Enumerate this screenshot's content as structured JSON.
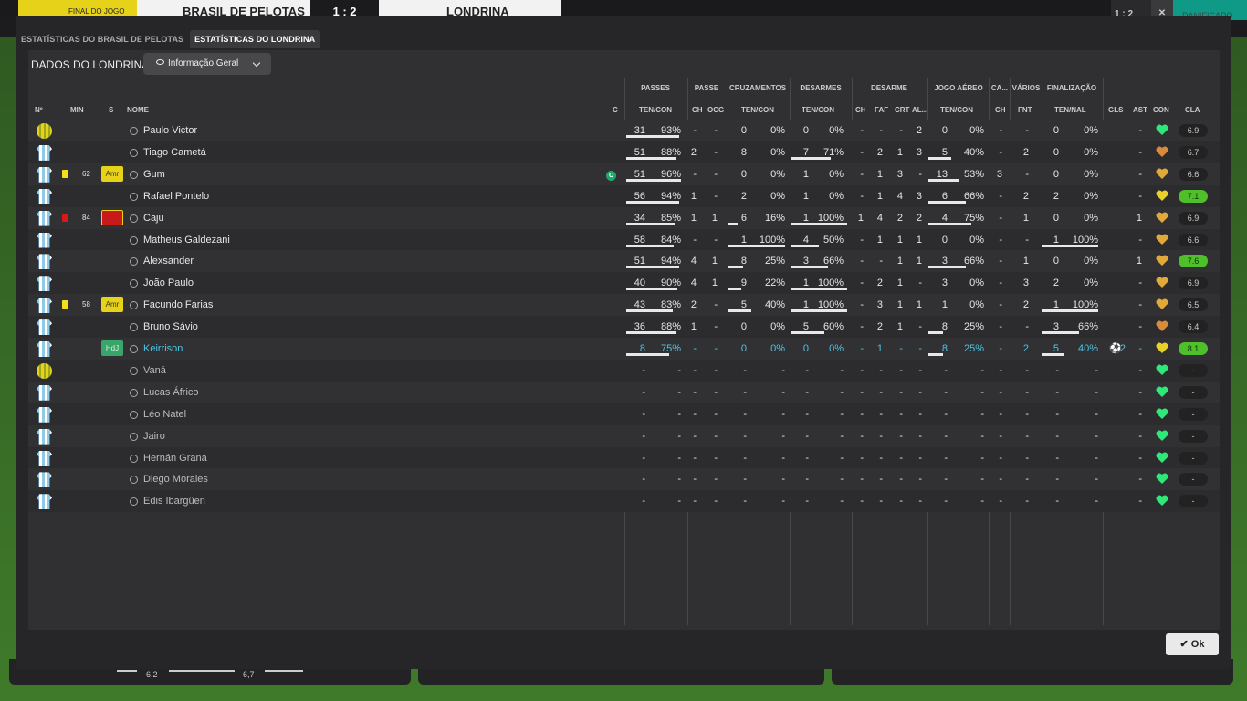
{
  "topbar": {
    "status": "FINAL DO JOGO",
    "home": "BRASIL DE PELOTAS",
    "score": "1 : 2",
    "away": "LONDRINA",
    "right_score": "1 : 2",
    "right_label": "DANIFICADO"
  },
  "bottom": {
    "val1": "6,2",
    "val2": "6,7"
  },
  "tabs": [
    {
      "label": "ESTATÍSTICAS DO BRASIL DE PELOTAS"
    },
    {
      "label": "ESTATÍSTICAS DO LONDRINA"
    }
  ],
  "panel": {
    "title": "DADOS DO LONDRINA",
    "dropdown": "Informação Geral"
  },
  "groups": [
    "PASSES",
    "PASSE",
    "CRUZAMENTOS",
    "DESARMES",
    "DESARME",
    "JOGO AÉREO",
    "CA...",
    "VÁRIOS",
    "FINALIZAÇÃO"
  ],
  "cols": {
    "no": "Nº",
    "min": "MIN",
    "s": "S",
    "name": "NOME",
    "c": "C",
    "passes": "TEN/CON",
    "passe_ch": "CH",
    "passe_ocg": "OCG",
    "cruz": "TEN/CON",
    "desarmes": "TEN/CON",
    "des_ch": "CH",
    "des_faf": "FAF",
    "des_crt": "CRT",
    "des_al": "AL...",
    "aereo": "TEN/CON",
    "ca_ch": "CH",
    "varios_fnt": "FNT",
    "final": "TEN/NAL",
    "gls": "GLS",
    "ast": "AST",
    "con": "CON",
    "cla": "CLA"
  },
  "players": [
    {
      "name": "Paulo Victor",
      "gk": true,
      "min": "",
      "badge": "",
      "card": "",
      "pt": "31",
      "pp": "93%",
      "pch": "-",
      "pocg": "-",
      "ct": "0",
      "cp": "0%",
      "dt": "0",
      "dp": "0%",
      "dch": "-",
      "dfaf": "-",
      "dcrt": "-",
      "dal": "2",
      "at": "0",
      "ap": "0%",
      "cach": "-",
      "fnt": "-",
      "ft": "0",
      "fp": "0%",
      "gls": "",
      "ast": "-",
      "rating": "6.9",
      "good": false,
      "heart": "green"
    },
    {
      "name": "Tiago Cametá",
      "gk": false,
      "min": "",
      "badge": "",
      "card": "",
      "pt": "51",
      "pp": "88%",
      "pch": "2",
      "pocg": "-",
      "ct": "8",
      "cp": "0%",
      "dt": "7",
      "dp": "71%",
      "dch": "-",
      "dfaf": "2",
      "dcrt": "1",
      "dal": "3",
      "at": "5",
      "ap": "40%",
      "cach": "-",
      "fnt": "2",
      "ft": "0",
      "fp": "0%",
      "gls": "",
      "ast": "-",
      "rating": "6.7",
      "good": false,
      "heart": "orange"
    },
    {
      "name": "Gum",
      "gk": false,
      "min": "62",
      "badge": "Amr",
      "card": "yellow",
      "cap": true,
      "pt": "51",
      "pp": "96%",
      "pch": "-",
      "pocg": "-",
      "ct": "0",
      "cp": "0%",
      "dt": "1",
      "dp": "0%",
      "dch": "-",
      "dfaf": "1",
      "dcrt": "3",
      "dal": "-",
      "at": "13",
      "ap": "53%",
      "cach": "3",
      "fnt": "-",
      "ft": "0",
      "fp": "0%",
      "gls": "",
      "ast": "-",
      "rating": "6.6",
      "good": false,
      "heart": "gold"
    },
    {
      "name": "Rafael Pontelo",
      "gk": false,
      "min": "",
      "badge": "",
      "card": "",
      "pt": "56",
      "pp": "94%",
      "pch": "1",
      "pocg": "-",
      "ct": "2",
      "cp": "0%",
      "dt": "1",
      "dp": "0%",
      "dch": "-",
      "dfaf": "1",
      "dcrt": "4",
      "dal": "3",
      "at": "6",
      "ap": "66%",
      "cach": "-",
      "fnt": "2",
      "ft": "2",
      "fp": "0%",
      "gls": "",
      "ast": "-",
      "rating": "7.1",
      "good": true,
      "heart": "yellow"
    },
    {
      "name": "Caju",
      "gk": false,
      "min": "84",
      "badge": "Vrm",
      "card": "red",
      "pt": "34",
      "pp": "85%",
      "pch": "1",
      "pocg": "1",
      "ct": "6",
      "cp": "16%",
      "dt": "1",
      "dp": "100%",
      "dch": "1",
      "dfaf": "4",
      "dcrt": "2",
      "dal": "2",
      "at": "4",
      "ap": "75%",
      "cach": "-",
      "fnt": "1",
      "ft": "0",
      "fp": "0%",
      "gls": "",
      "ast": "1",
      "rating": "6.9",
      "good": false,
      "heart": "gold"
    },
    {
      "name": "Matheus Galdezani",
      "gk": false,
      "min": "",
      "badge": "",
      "card": "",
      "pt": "58",
      "pp": "84%",
      "pch": "-",
      "pocg": "-",
      "ct": "1",
      "cp": "100%",
      "dt": "4",
      "dp": "50%",
      "dch": "-",
      "dfaf": "1",
      "dcrt": "1",
      "dal": "1",
      "at": "0",
      "ap": "0%",
      "cach": "-",
      "fnt": "-",
      "ft": "1",
      "fp": "100%",
      "gls": "",
      "ast": "-",
      "rating": "6.6",
      "good": false,
      "heart": "gold"
    },
    {
      "name": "Alexsander",
      "gk": false,
      "min": "",
      "badge": "",
      "card": "",
      "pt": "51",
      "pp": "94%",
      "pch": "4",
      "pocg": "1",
      "ct": "8",
      "cp": "25%",
      "dt": "3",
      "dp": "66%",
      "dch": "-",
      "dfaf": "-",
      "dcrt": "1",
      "dal": "1",
      "at": "3",
      "ap": "66%",
      "cach": "-",
      "fnt": "1",
      "ft": "0",
      "fp": "0%",
      "gls": "",
      "ast": "1",
      "rating": "7.6",
      "good": true,
      "heart": "gold"
    },
    {
      "name": "João Paulo",
      "gk": false,
      "min": "",
      "badge": "",
      "card": "",
      "pt": "40",
      "pp": "90%",
      "pch": "4",
      "pocg": "1",
      "ct": "9",
      "cp": "22%",
      "dt": "1",
      "dp": "100%",
      "dch": "-",
      "dfaf": "2",
      "dcrt": "1",
      "dal": "-",
      "at": "3",
      "ap": "0%",
      "cach": "-",
      "fnt": "3",
      "ft": "2",
      "fp": "0%",
      "gls": "",
      "ast": "-",
      "rating": "6.9",
      "good": false,
      "heart": "gold"
    },
    {
      "name": "Facundo Farias",
      "gk": false,
      "min": "58",
      "badge": "Amr",
      "card": "yellow",
      "pt": "43",
      "pp": "83%",
      "pch": "2",
      "pocg": "-",
      "ct": "5",
      "cp": "40%",
      "dt": "1",
      "dp": "100%",
      "dch": "-",
      "dfaf": "3",
      "dcrt": "1",
      "dal": "1",
      "at": "1",
      "ap": "0%",
      "cach": "-",
      "fnt": "2",
      "ft": "1",
      "fp": "100%",
      "gls": "",
      "ast": "-",
      "rating": "6.5",
      "good": false,
      "heart": "gold"
    },
    {
      "name": "Bruno Sávio",
      "gk": false,
      "min": "",
      "badge": "",
      "card": "",
      "pt": "36",
      "pp": "88%",
      "pch": "1",
      "pocg": "-",
      "ct": "0",
      "cp": "0%",
      "dt": "5",
      "dp": "60%",
      "dch": "-",
      "dfaf": "2",
      "dcrt": "1",
      "dal": "-",
      "at": "8",
      "ap": "25%",
      "cach": "-",
      "fnt": "-",
      "ft": "3",
      "fp": "66%",
      "gls": "",
      "ast": "-",
      "rating": "6.4",
      "good": false,
      "heart": "orange"
    },
    {
      "name": "Keirrison",
      "gk": false,
      "min": "",
      "badge": "HdJ",
      "card": "",
      "highlight": true,
      "pt": "8",
      "pp": "75%",
      "pch": "-",
      "pocg": "-",
      "ct": "0",
      "cp": "0%",
      "dt": "0",
      "dp": "0%",
      "dch": "-",
      "dfaf": "1",
      "dcrt": "-",
      "dal": "-",
      "at": "8",
      "ap": "25%",
      "cach": "-",
      "fnt": "2",
      "ft": "5",
      "fp": "40%",
      "gls": "2",
      "ast": "-",
      "rating": "8.1",
      "good": true,
      "heart": "yellow"
    },
    {
      "name": "Vaná",
      "gk": true,
      "sub": true,
      "pt": "-",
      "pp": "-",
      "pch": "-",
      "pocg": "-",
      "ct": "-",
      "cp": "-",
      "dt": "-",
      "dp": "-",
      "dch": "-",
      "dfaf": "-",
      "dcrt": "-",
      "dal": "-",
      "at": "-",
      "ap": "-",
      "cach": "-",
      "fnt": "-",
      "ft": "-",
      "fp": "-",
      "gls": "",
      "ast": "-",
      "rating": "-",
      "good": false,
      "heart": "green"
    },
    {
      "name": "Lucas Áfrico",
      "gk": false,
      "sub": true,
      "pt": "-",
      "pp": "-",
      "pch": "-",
      "pocg": "-",
      "ct": "-",
      "cp": "-",
      "dt": "-",
      "dp": "-",
      "dch": "-",
      "dfaf": "-",
      "dcrt": "-",
      "dal": "-",
      "at": "-",
      "ap": "-",
      "cach": "-",
      "fnt": "-",
      "ft": "-",
      "fp": "-",
      "gls": "",
      "ast": "-",
      "rating": "-",
      "good": false,
      "heart": "green"
    },
    {
      "name": "Léo Natel",
      "gk": false,
      "sub": true,
      "pt": "-",
      "pp": "-",
      "pch": "-",
      "pocg": "-",
      "ct": "-",
      "cp": "-",
      "dt": "-",
      "dp": "-",
      "dch": "-",
      "dfaf": "-",
      "dcrt": "-",
      "dal": "-",
      "at": "-",
      "ap": "-",
      "cach": "-",
      "fnt": "-",
      "ft": "-",
      "fp": "-",
      "gls": "",
      "ast": "-",
      "rating": "-",
      "good": false,
      "heart": "green"
    },
    {
      "name": "Jairo",
      "gk": false,
      "sub": true,
      "pt": "-",
      "pp": "-",
      "pch": "-",
      "pocg": "-",
      "ct": "-",
      "cp": "-",
      "dt": "-",
      "dp": "-",
      "dch": "-",
      "dfaf": "-",
      "dcrt": "-",
      "dal": "-",
      "at": "-",
      "ap": "-",
      "cach": "-",
      "fnt": "-",
      "ft": "-",
      "fp": "-",
      "gls": "",
      "ast": "-",
      "rating": "-",
      "good": false,
      "heart": "green"
    },
    {
      "name": "Hernán Grana",
      "gk": false,
      "sub": true,
      "pt": "-",
      "pp": "-",
      "pch": "-",
      "pocg": "-",
      "ct": "-",
      "cp": "-",
      "dt": "-",
      "dp": "-",
      "dch": "-",
      "dfaf": "-",
      "dcrt": "-",
      "dal": "-",
      "at": "-",
      "ap": "-",
      "cach": "-",
      "fnt": "-",
      "ft": "-",
      "fp": "-",
      "gls": "",
      "ast": "-",
      "rating": "-",
      "good": false,
      "heart": "green"
    },
    {
      "name": "Diego Morales",
      "gk": false,
      "sub": true,
      "pt": "-",
      "pp": "-",
      "pch": "-",
      "pocg": "-",
      "ct": "-",
      "cp": "-",
      "dt": "-",
      "dp": "-",
      "dch": "-",
      "dfaf": "-",
      "dcrt": "-",
      "dal": "-",
      "at": "-",
      "ap": "-",
      "cach": "-",
      "fnt": "-",
      "ft": "-",
      "fp": "-",
      "gls": "",
      "ast": "-",
      "rating": "-",
      "good": false,
      "heart": "green"
    },
    {
      "name": "Edis Ibargüen",
      "gk": false,
      "sub": true,
      "pt": "-",
      "pp": "-",
      "pch": "-",
      "pocg": "-",
      "ct": "-",
      "cp": "-",
      "dt": "-",
      "dp": "-",
      "dch": "-",
      "dfaf": "-",
      "dcrt": "-",
      "dal": "-",
      "at": "-",
      "ap": "-",
      "cach": "-",
      "fnt": "-",
      "ft": "-",
      "fp": "-",
      "gls": "",
      "ast": "-",
      "rating": "-",
      "good": false,
      "heart": "green"
    }
  ],
  "colors": {
    "heart_green": "#2ee87a",
    "heart_gold": "#e0a93a",
    "heart_orange": "#d98a3a",
    "heart_yellow": "#e8d22a",
    "highlight": "#4fc3e0",
    "card_yellow": "#f2e21a",
    "card_red": "#d61a1a"
  },
  "ok": {
    "label": "Ok"
  }
}
